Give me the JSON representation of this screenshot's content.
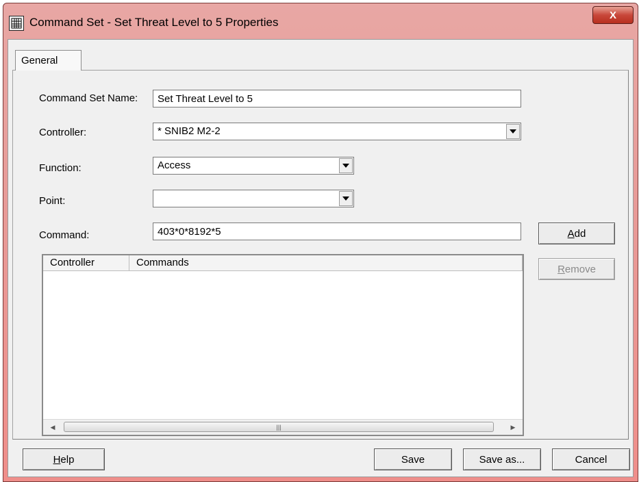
{
  "window": {
    "title": "Command Set - Set Threat Level to 5 Properties",
    "close_label": "X"
  },
  "tabs": [
    {
      "label": "General"
    }
  ],
  "form": {
    "command_set_name_label": "Command Set Name:",
    "command_set_name_value": "Set Threat Level to 5",
    "controller_label": "Controller:",
    "controller_value": "* SNIB2 M2-2",
    "function_label": "Function:",
    "function_value": "Access",
    "point_label": "Point:",
    "point_value": "",
    "command_label": "Command:",
    "command_value": "403*0*8192*5"
  },
  "side_buttons": {
    "add_label": "Add",
    "add_accel": "A",
    "add_rest": "dd",
    "remove_label": "Remove",
    "remove_accel": "R",
    "remove_rest": "emove"
  },
  "list": {
    "columns": [
      "Controller",
      "Commands"
    ],
    "rows": []
  },
  "footer": {
    "help_label": "Help",
    "help_accel": "H",
    "help_rest": "elp",
    "save_label": "Save",
    "save_as_label": "Save as...",
    "cancel_label": "Cancel"
  },
  "icons": {
    "app": "command-set-icon",
    "dropdown": "chevron-down-icon",
    "scroll_left": "scroll-left-icon",
    "scroll_right": "scroll-right-icon"
  },
  "colors": {
    "titlebar": "#e79b98",
    "close_button": "#c8473a",
    "dialog_bg": "#f0f0f0"
  }
}
